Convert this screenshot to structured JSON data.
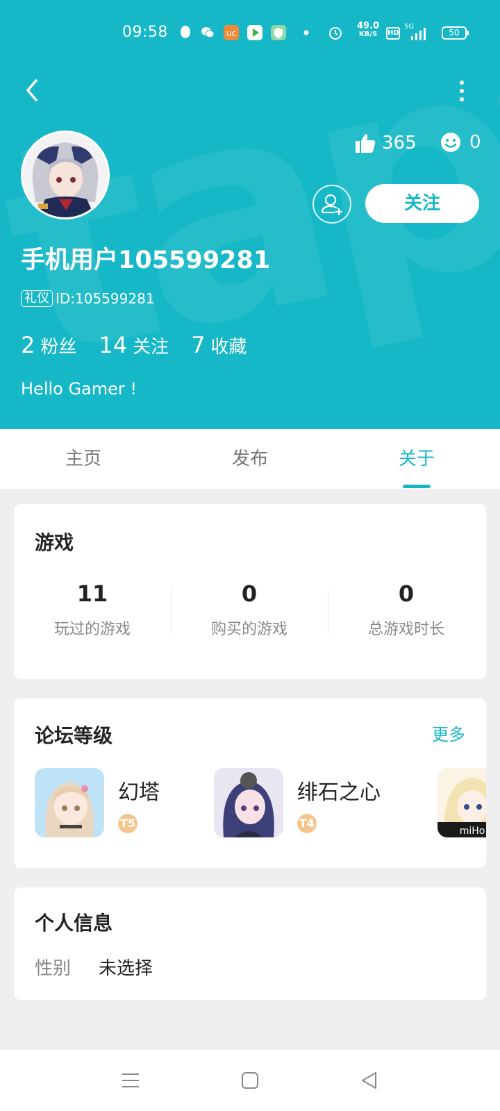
{
  "status_bar": {
    "time": "09:58",
    "net_speed_value": "49.0",
    "net_speed_unit": "KB/S",
    "hd": "HD",
    "network": "5G",
    "battery": "50"
  },
  "profile": {
    "likes": "365",
    "smiles": "0",
    "follow_label": "关注",
    "username": "手机用户105599281",
    "id_badge": "礼仪",
    "id_text": "ID:105599281",
    "fans_count": "2",
    "fans_label": "粉丝",
    "following_count": "14",
    "following_label": "关注",
    "favorites_count": "7",
    "favorites_label": "收藏",
    "bio": "Hello Gamer !"
  },
  "tabs": [
    {
      "label": "主页",
      "active": false
    },
    {
      "label": "发布",
      "active": false
    },
    {
      "label": "关于",
      "active": true
    }
  ],
  "games_card": {
    "title": "游戏",
    "stats": [
      {
        "value": "11",
        "label": "玩过的游戏"
      },
      {
        "value": "0",
        "label": "购买的游戏"
      },
      {
        "value": "0",
        "label": "总游戏时长"
      }
    ]
  },
  "forum_card": {
    "title": "论坛等级",
    "more_label": "更多",
    "items": [
      {
        "name": "幻塔",
        "level": "T5"
      },
      {
        "name": "绯石之心",
        "level": "T4"
      },
      {
        "name": "",
        "level": ""
      }
    ],
    "third_icon_text": "miHo"
  },
  "info_card": {
    "title": "个人信息",
    "gender_label": "性别",
    "gender_value": "未选择"
  },
  "colors": {
    "accent": "#16b8c8",
    "badge": "#f5c58e"
  },
  "icons": [
    "back-arrow-icon",
    "more-dots-icon",
    "thumbs-up-icon",
    "smile-icon",
    "add-friend-icon",
    "menu-icon",
    "home-square-icon",
    "back-triangle-icon"
  ]
}
